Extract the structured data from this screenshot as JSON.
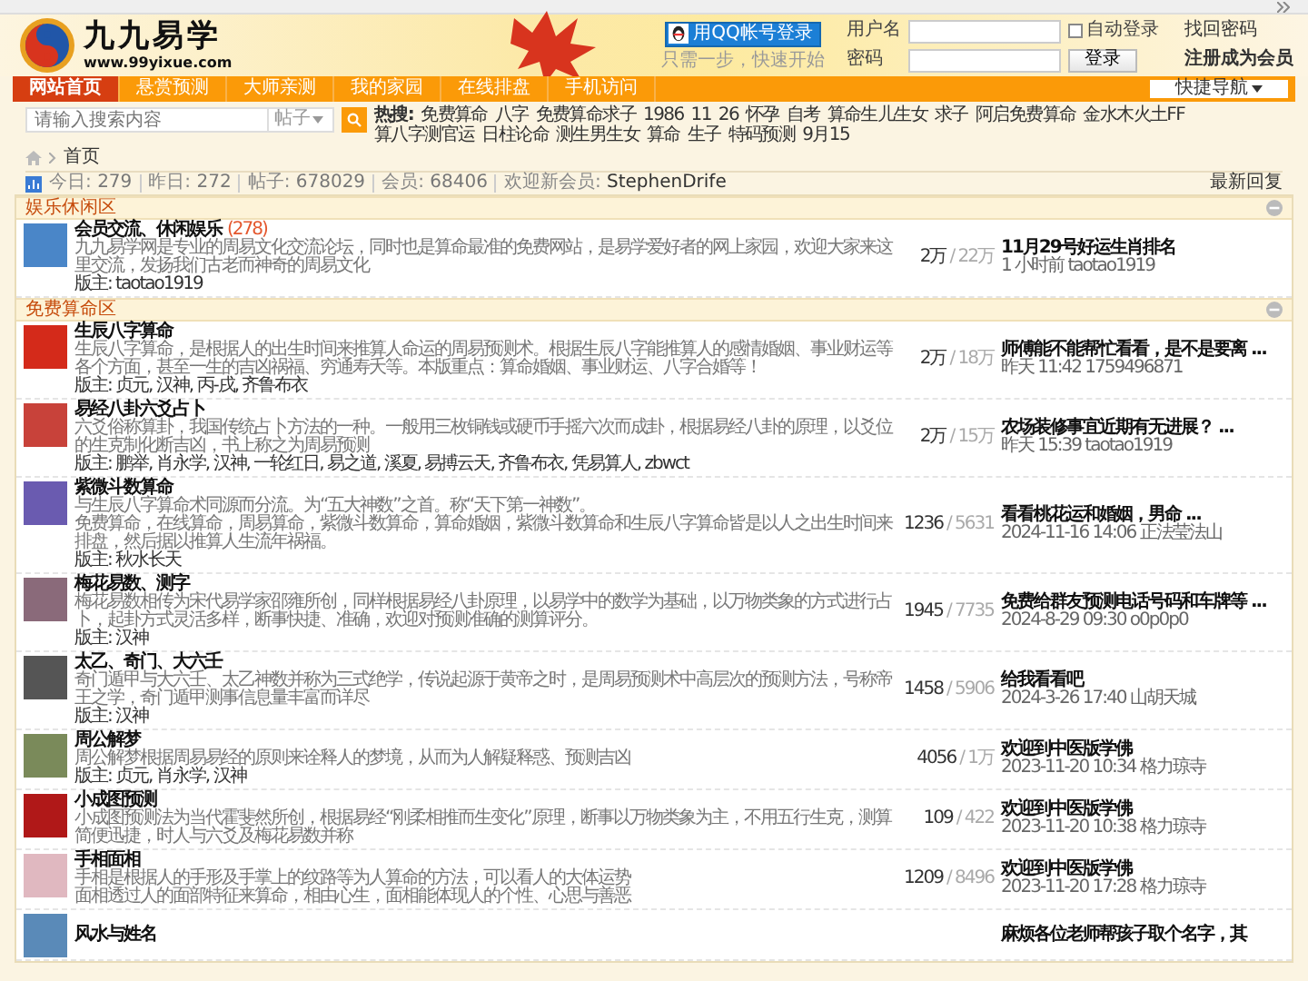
{
  "logo": {
    "title": "九九易学",
    "url": "www.99yixue.com"
  },
  "qq_login": {
    "button": "用QQ帐号登录",
    "hint": "只需一步，快速开始"
  },
  "login": {
    "username_label": "用户名",
    "password_label": "密码",
    "auto_login": {
      "label": "自动登录",
      "checked": false
    },
    "submit": "登录",
    "find_password": "找回密码",
    "register": "注册成为会员"
  },
  "nav": {
    "items": [
      {
        "label": "网站首页",
        "selected": true
      },
      {
        "label": "悬赏预测",
        "selected": false
      },
      {
        "label": "大师亲测",
        "selected": false
      },
      {
        "label": "我的家园",
        "selected": false
      },
      {
        "label": "在线排盘",
        "selected": false
      },
      {
        "label": "手机访问",
        "selected": false
      }
    ],
    "quick_nav": "快捷导航"
  },
  "search": {
    "placeholder": "请输入搜索内容",
    "scope": "帖子",
    "hot_label": "热搜:",
    "hot": [
      "免费算命",
      "八字",
      "免费算命求子",
      "1986",
      "11",
      "26",
      "怀孕",
      "自考",
      "算命生儿生女",
      "求子",
      "阿启免费算命",
      "金水木火土FF",
      "算八字测官运",
      "日柱论命",
      "测生男生女",
      "算命",
      "生子",
      "特码预测",
      "9月15"
    ]
  },
  "breadcrumb": [
    "首页"
  ],
  "stats": {
    "items": [
      {
        "label": "今日:",
        "value": "279"
      },
      {
        "label": "昨日:",
        "value": "272"
      },
      {
        "label": "帖子:",
        "value": "678029"
      },
      {
        "label": "会员:",
        "value": "68406"
      },
      {
        "label": "欢迎新会员:",
        "value": "StephenDrife"
      }
    ],
    "latest_replies": "最新回复"
  },
  "categories": [
    {
      "title": "娱乐休闲区",
      "collapsed": false,
      "forums": [
        {
          "name": "会员交流、休闲娱乐",
          "today": "(278)",
          "description": [
            "九九易学网是专业的周易文化交流论坛，同时也是算命最准的免费网站，是易学爱好者的网上家园，欢迎大家来这里交流，发扬我们古老而神奇的周易文化"
          ],
          "moderators": "版主: taotao1919",
          "threads": "2万",
          "posts": "/ 22万",
          "last_title": "11月29号好运生肖排名",
          "last_time": "1 小时前 taotao1919",
          "color": "#4a86c8"
        }
      ]
    },
    {
      "title": "免费算命区",
      "collapsed": false,
      "forums": [
        {
          "name": "生辰八字算命",
          "description": [
            "生辰八字算命，是根据人的出生时间来推算人命运的周易预测术。根据生辰八字能推算人的感情婚姻、事业财运等各个方面，甚至一生的吉凶祸福、穷通寿夭等。本版重点：算命婚姻、事业财运、八字合婚等！"
          ],
          "moderators": "版主: 贞元, 汉神, 丙-戌, 齐鲁布衣",
          "threads": "2万",
          "posts": "/ 18万",
          "last_title": "师傅能不能帮忙看看，是不是要离 ...",
          "last_time": "昨天 11:42 1759496871",
          "color": "#d42a1a"
        },
        {
          "name": "易经八卦六爻占卜",
          "description": [
            "六爻俗称算卦，我国传统占卜方法的一种。一般用三枚铜钱或硬币手摇六次而成卦，根据易经八卦的原理，以爻位的生克制化断吉凶，书上称之为周易预测"
          ],
          "moderators": "版主: 鹏举, 肖永学, 汉神, 一轮红日, 易之道, 溪夏, 易搏云天, 齐鲁布衣, 凭易算人, zbwct",
          "threads": "2万",
          "posts": "/ 15万",
          "last_title": "农场装修事宜近期有无进展？ ...",
          "last_time": "昨天 15:39 taotao1919",
          "color": "#c8423a"
        },
        {
          "name": "紫微斗数算命",
          "description": [
            "与生辰八字算命术同源而分流。为“五大神数”之首。称“天下第一神数”。",
            "免费算命，在线算命，周易算命，紫微斗数算命，算命婚姻，紫微斗数算命和生辰八字算命皆是以人之出生时间来排盘，然后据以推算人生流年祸福。"
          ],
          "moderators": "版主: 秋水长天",
          "threads": "1236",
          "posts": "/ 5631",
          "last_title": "看看桃花运和婚姻，男命 ...",
          "last_time": "2024-11-16 14:06 正法莹法山",
          "color": "#6a5bb0"
        },
        {
          "name": "梅花易数、测字",
          "description": [
            "梅花易数相传为宋代易学家邵雍所创，同样根据易经八卦原理，以易学中的数学为基础，以万物类象的方式进行占卜，起卦方式灵活多样，断事快捷、准确，欢迎对预测准确的测算评分。"
          ],
          "moderators": "版主: 汉神",
          "threads": "1945",
          "posts": "/ 7735",
          "last_title": "免费给群友预测电话号码和车牌等 ...",
          "last_time": "2024-8-29 09:30 o0p0p0",
          "color": "#8a6a7a"
        },
        {
          "name": "太乙、奇门、大六壬",
          "description": [
            "奇门遁甲与大六壬、太乙神数并称为三式绝学，传说起源于黄帝之时，是周易预测术中高层次的预测方法，号称帝王之学，奇门遁甲测事信息量丰富而详尽"
          ],
          "moderators": "版主: 汉神",
          "threads": "1458",
          "posts": "/ 5906",
          "last_title": "给我看看吧",
          "last_time": "2024-3-26 17:40 山胡天城",
          "color": "#555555"
        },
        {
          "name": "周公解梦",
          "description": [
            "周公解梦根据周易易经的原则来诠释人的梦境，从而为人解疑释惑、预测吉凶"
          ],
          "moderators": "版主: 贞元, 肖永学, 汉神",
          "threads": "4056",
          "posts": "/ 1万",
          "last_title": "欢迎到中医版学佛",
          "last_time": "2023-11-20 10:34 格力琼寺",
          "color": "#7a8a5a"
        },
        {
          "name": "小成图预测",
          "description": [
            "小成图预测法为当代霍斐然所创，根据易经“刚柔相推而生变化”原理，断事以万物类象为主，不用五行生克，测算简便迅捷，时人与六爻及梅花易数并称"
          ],
          "threads": "109",
          "posts": "/ 422",
          "last_title": "欢迎到中医版学佛",
          "last_time": "2023-11-20 10:38 格力琼寺",
          "color": "#b01818"
        },
        {
          "name": "手相面相",
          "description": [
            "手相是根据人的手形及手掌上的纹路等为人算命的方法，可以看人的大体运势",
            "面相透过人的面部特征来算命，相由心生，面相能体现人的个性、心思与善恶"
          ],
          "threads": "1209",
          "posts": "/ 8496",
          "last_title": "欢迎到中医版学佛",
          "last_time": "2023-11-20 17:28 格力琼寺",
          "color": "#e0b8c0"
        },
        {
          "name": "风水与姓名",
          "last_title": "麻烦各位老师帮孩子取个名字，其",
          "color": "#5a8ab8"
        }
      ]
    }
  ]
}
